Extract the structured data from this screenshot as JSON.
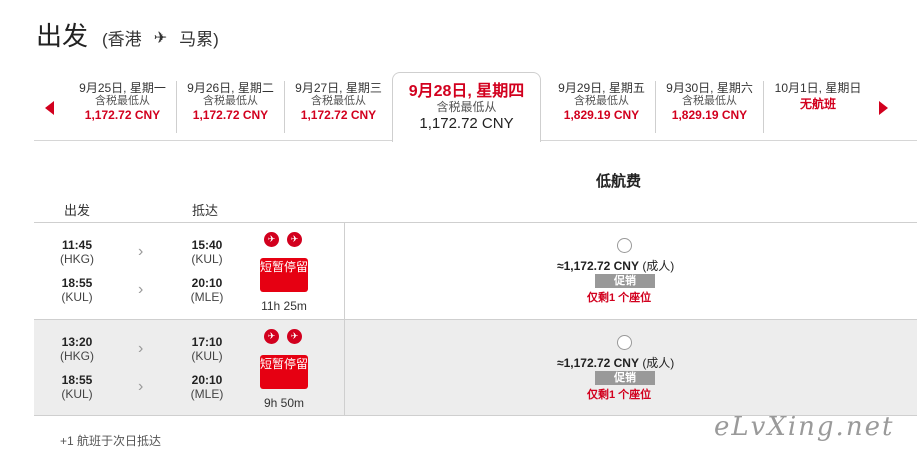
{
  "header": {
    "title": "出发",
    "origin": "(香港",
    "destination": "马累)"
  },
  "dates": [
    {
      "date": "9月25日, 星期一",
      "sub": "含税最低从",
      "price": "1,172.72 CNY"
    },
    {
      "date": "9月26日, 星期二",
      "sub": "含税最低从",
      "price": "1,172.72 CNY"
    },
    {
      "date": "9月27日, 星期三",
      "sub": "含税最低从",
      "price": "1,172.72 CNY"
    },
    {
      "date": "9月29日, 星期五",
      "sub": "含税最低从",
      "price": "1,829.19 CNY"
    },
    {
      "date": "9月30日, 星期六",
      "sub": "含税最低从",
      "price": "1,829.19 CNY"
    },
    {
      "date": "10月1日, 星期日",
      "sub": "",
      "price": "无航班"
    }
  ],
  "selected_date": {
    "date": "9月28日, 星期四",
    "sub": "含税最低从",
    "price": "1,172.72 CNY"
  },
  "fare_heading": "低航费",
  "columns": {
    "depart": "出发",
    "arrive": "抵达"
  },
  "flights": [
    {
      "leg1": {
        "dep_time": "11:45",
        "dep_code": "(HKG)",
        "arr_time": "15:40",
        "arr_code": "(KUL)"
      },
      "leg2": {
        "dep_time": "18:55",
        "dep_code": "(KUL)",
        "arr_time": "20:10",
        "arr_code": "(MLE)"
      },
      "stop_label": "短暂停留",
      "duration": "11h 25m",
      "price": "≈1,172.72 CNY",
      "pax": "(成人)",
      "promo": "促销",
      "seats": "仅剩1 个座位"
    },
    {
      "leg1": {
        "dep_time": "13:20",
        "dep_code": "(HKG)",
        "arr_time": "17:10",
        "arr_code": "(KUL)"
      },
      "leg2": {
        "dep_time": "18:55",
        "dep_code": "(KUL)",
        "arr_time": "20:10",
        "arr_code": "(MLE)"
      },
      "stop_label": "短暂停留",
      "duration": "9h 50m",
      "price": "≈1,172.72 CNY",
      "pax": "(成人)",
      "promo": "促销",
      "seats": "仅剩1 个座位"
    }
  ],
  "footnote": "+1 航班于次日抵达",
  "watermark": "eLvXing.net",
  "colors": {
    "accent": "#d2001e",
    "promo_bg": "#999999",
    "row_alt": "#ededed"
  }
}
